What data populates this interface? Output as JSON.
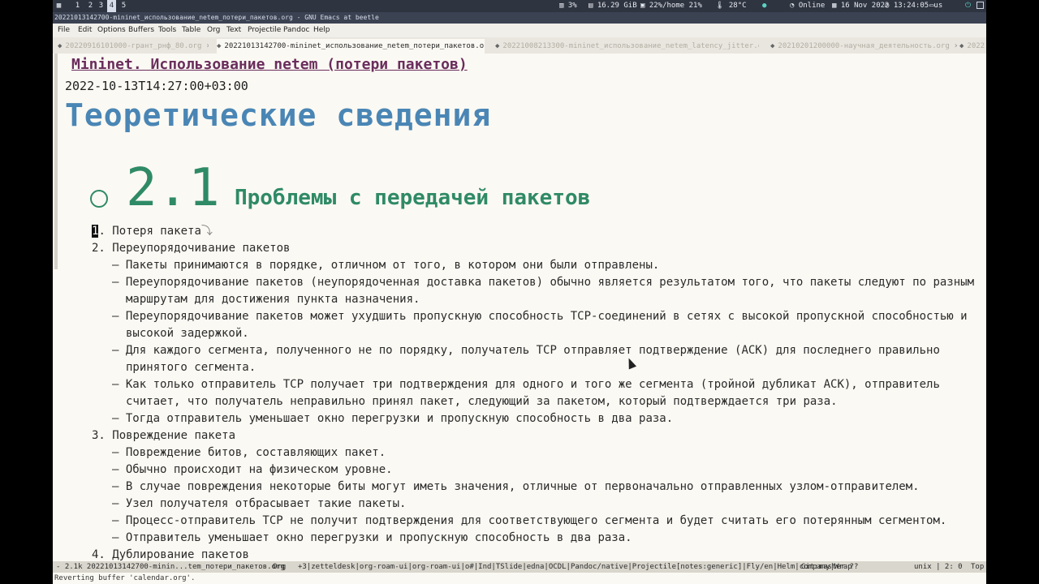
{
  "topbar": {
    "workspaces": [
      "1",
      "2",
      "3",
      "4",
      "5"
    ],
    "active_workspace": "4",
    "cpu": "3%",
    "memory": "16.29 GiB",
    "disk": "22%/home 21%",
    "temperature": "28°C",
    "network": "Online",
    "date": "16 Nov 2022",
    "time": "13:24:05",
    "keyboard": "us"
  },
  "titlebar": {
    "title": "20221013142700-mininet_использование_netem_потери_пакетов.org - GNU Emacs at beetle"
  },
  "menubar": {
    "items": [
      "File",
      "Edit",
      "Options",
      "Buffers",
      "Tools",
      "Table",
      "Org",
      "Text",
      "Projectile",
      "Pandoc",
      "Help"
    ]
  },
  "tabs": [
    {
      "label": "20220916101000-грант_рнф_80.org",
      "close": "×"
    },
    {
      "label": "20221013142700-mininet_использование_netem_потери_пакетов.org",
      "close": "×"
    },
    {
      "label": "20221008213300-mininet_использование_netem_latency_jitter.org",
      "close": "×"
    },
    {
      "label": "20210201200000-научная_деятельность.org",
      "close": "×"
    },
    {
      "label": "2022"
    }
  ],
  "document": {
    "title": "Mininet. Использование netem (потери пакетов)",
    "date": "2022-10-13T14:27:00+03:00",
    "heading1": "Теоретические сведения",
    "heading2_number": "2.1",
    "heading2_text": "Проблемы с передачей пакетов",
    "lines": [
      {
        "prefix": "",
        "cursor": "1",
        "text": ". Потеря пакета",
        "suffix": "⤵"
      },
      {
        "prefix": "2. ",
        "text": "Переупорядочивание пакетов"
      },
      {
        "prefix": "– ",
        "text": "Пакеты принимаются в порядке, отличном от того, в котором они были отправлены."
      },
      {
        "prefix": "– ",
        "text": "Переупорядочивание пакетов (неупорядоченная доставка пакетов) обычно является результатом того, что пакеты следуют по разным"
      },
      {
        "prefix": "",
        "text": "маршрутам для достижения пункта назначения."
      },
      {
        "prefix": "– ",
        "text": "Переупорядочивание пакетов может ухудшить пропускную способность TCP-соединений в сетях с высокой пропускной способностью и"
      },
      {
        "prefix": "",
        "text": "высокой задержкой."
      },
      {
        "prefix": "– ",
        "text": "Для каждого сегмента, полученного не по порядку, получатель TCP отправляет подтверждение (ACK) для последнего правильно"
      },
      {
        "prefix": "",
        "text": "принятого сегмента."
      },
      {
        "prefix": "– ",
        "text": "Как только отправитель TCP получает три подтверждения для одного и того же сегмента (тройной дубликат ACK), отправитель"
      },
      {
        "prefix": "",
        "text": "считает, что получатель неправильно принял пакет, следующий за пакетом, который подтверждается три раза."
      },
      {
        "prefix": "– ",
        "text": "Тогда отправитель уменьшает окно перегрузки и пропускную способность в два раза."
      },
      {
        "prefix": "3. ",
        "text": "Повреждение пакета"
      },
      {
        "prefix": "– ",
        "text": "Повреждение битов, составляющих пакет."
      },
      {
        "prefix": "– ",
        "text": "Обычно происходит на физическом уровне."
      },
      {
        "prefix": "– ",
        "text": "В случае повреждения некоторые биты могут иметь значения, отличные от первоначально отправленных узлом-отправителем."
      },
      {
        "prefix": "– ",
        "text": "Узел получателя отбрасывает такие пакеты."
      },
      {
        "prefix": "– ",
        "text": "Процесс-отправитель TCP не получит подтверждения для соответствующего сегмента и будет считать его потерянным сегментом."
      },
      {
        "prefix": "– ",
        "text": "Отправитель уменьшает окно перегрузки и пропускную способность в два раза."
      },
      {
        "prefix": "4. ",
        "text": "Дублирование пакетов"
      }
    ]
  },
  "modeline": {
    "left": "- 2.1k 20221013142700-minin...tem_потери_пакетов.org",
    "mode": "Org",
    "minor_modes": "+3|zetteldesk|org-roam-ui|org-roam-ui|o#|Ind|TSlide|edna|OCDL|Pandoc/native|Projectile[notes:generic]|Fly/en|Helm|company|Wrap",
    "git": "Git:master ??",
    "encoding": "unix | 2: 0",
    "position": "Top"
  },
  "echo_area": {
    "message": "Reverting buffer 'calendar.org'."
  }
}
